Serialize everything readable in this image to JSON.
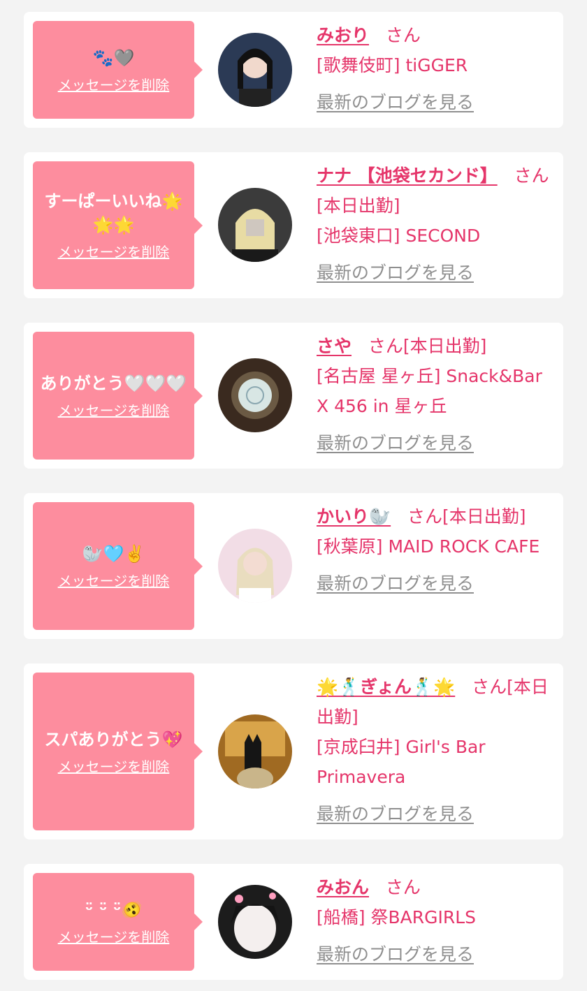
{
  "delete_label": "メッセージを削除",
  "blog_label": "最新のブログを見る",
  "cards": [
    {
      "message": "🐾🩶",
      "name": "みおり",
      "honorific": "さん",
      "status": "",
      "shop": "[歌舞伎町] tiGGER"
    },
    {
      "message": "すーぱーいいね🌟🌟🌟",
      "name": "ナナ 【池袋セカンド】",
      "honorific": "さ",
      "status": "ん[本日出勤]",
      "shop": "[池袋東口] SECOND"
    },
    {
      "message": "ありがとう🤍🤍🤍",
      "name": "さや",
      "honorific": "さん",
      "status": "[本日出勤]",
      "shop": "[名古屋 星ヶ丘] Snack&Bar X 456 in 星ヶ丘"
    },
    {
      "message": "🦭🩵✌️",
      "name": "かいり🦭",
      "honorific": "さん",
      "status": "[本日出勤]",
      "shop": "[秋葉原] MAID ROCK CAFE"
    },
    {
      "message": "スパありがとう💖",
      "name": "🌟🕺ぎょん🕺🌟",
      "honorific": "さん",
      "status": "[本日出勤]",
      "shop": "[京成臼井] Girl's Bar Primavera"
    },
    {
      "message": "ᵕ̈ ᵕ̈ ᵕ̈🫨",
      "name": "みおん",
      "honorific": "さん",
      "status": "",
      "shop": "[船橋] 祭BARGIRLS"
    }
  ],
  "colors": {
    "accent": "#e5356a",
    "bubble": "#fd8d9e",
    "muted": "#8f8f8f",
    "background": "#f3f3f3"
  }
}
